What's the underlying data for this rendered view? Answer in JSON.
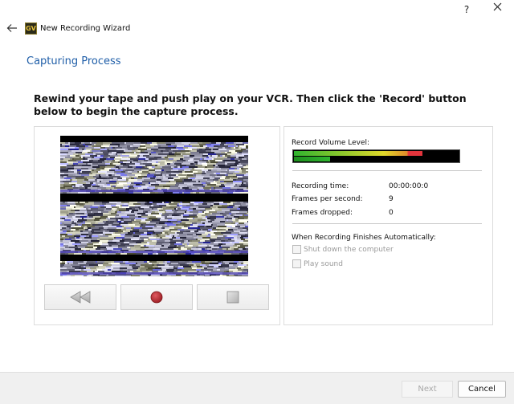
{
  "window": {
    "title": "New Recording Wizard",
    "logo_text": "GV",
    "help_label": "?"
  },
  "page": {
    "heading": "Capturing Process",
    "instructions": "Rewind your tape and push play on your VCR. Then click the 'Record' button below to begin the capture process."
  },
  "controls": {
    "rewind_icon": "rewind-icon",
    "record_icon": "record-icon",
    "stop_icon": "stop-icon"
  },
  "recording": {
    "volume_label": "Record Volume Level:",
    "volume_level_top": 0.78,
    "volume_level_bottom": 0.22,
    "stats": [
      {
        "label": "Recording time:",
        "value": "00:00:00:0"
      },
      {
        "label": "Frames per second:",
        "value": "9"
      },
      {
        "label": "Frames dropped:",
        "value": "0"
      }
    ],
    "auto_finish_label": "When Recording Finishes Automatically:",
    "options": [
      {
        "label": "Shut down the computer",
        "checked": false,
        "enabled": false
      },
      {
        "label": "Play sound",
        "checked": false,
        "enabled": false
      }
    ]
  },
  "footer": {
    "next_label": "Next",
    "cancel_label": "Cancel"
  },
  "colors": {
    "accent": "#1f5ea8",
    "meter_green": "#2fb52f",
    "meter_yellow": "#e0d82a",
    "meter_red": "#e2343c",
    "record_red": "#b8262c"
  }
}
